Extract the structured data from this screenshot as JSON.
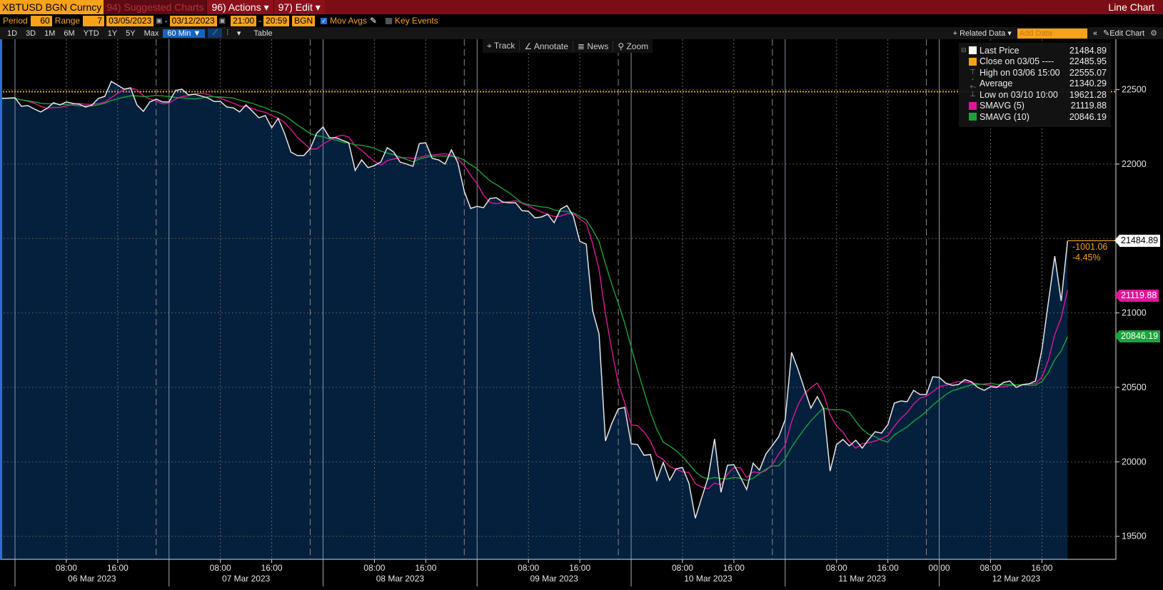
{
  "header": {
    "ticker": "XBTUSD BGN Curncy",
    "suggested": "94) Suggested Charts",
    "actions": "96) Actions ▾",
    "edit": "97) Edit ▾",
    "chart_type": "Line Chart"
  },
  "settings": {
    "period_label": "Period",
    "period_value": "60",
    "range_label": "Range",
    "range_value": "7",
    "start_date": "03/05/2023",
    "end_date": "03/12/2023",
    "start_time": "21:00",
    "end_time": "20:59",
    "source": "BGN",
    "mov_avgs": "Mov Avgs",
    "mov_avgs_checked": true,
    "key_events": "Key Events",
    "key_events_checked": false
  },
  "ranges": [
    "1D",
    "3D",
    "1M",
    "6M",
    "YTD",
    "1Y",
    "5Y",
    "Max"
  ],
  "interval": "60 Min ▼",
  "table_label": "Table",
  "related_data": "+ Related Data ▾",
  "add_data_placeholder": "Add Data",
  "edit_chart": "Edit Chart",
  "tools": [
    "Track",
    "Annotate",
    "News",
    "Zoom"
  ],
  "legend": [
    {
      "label": "Last Price",
      "value": "21484.89",
      "color": "#ffffff",
      "marker": "swatch"
    },
    {
      "label": "Close on 03/05 ----",
      "value": "22485.95",
      "color": "#f7a21b",
      "marker": "swatch"
    },
    {
      "label": "High on 03/06 15:00",
      "value": "22555.07",
      "marker": "high"
    },
    {
      "label": "Average",
      "value": "21340.29",
      "marker": "avg"
    },
    {
      "label": "Low on 03/10 10:00",
      "value": "19621.28",
      "marker": "low"
    },
    {
      "label": "SMAVG (5)",
      "value": "21119.88",
      "color": "#e0169a",
      "marker": "swatch"
    },
    {
      "label": "SMAVG (10)",
      "value": "20846.19",
      "color": "#1aa33a",
      "marker": "swatch"
    }
  ],
  "tags": {
    "last": "21484.89",
    "sma5": "21119.88",
    "sma10": "20846.19",
    "change": "-1001.06",
    "change_pct": "-4.45%"
  },
  "chart_data": {
    "type": "area",
    "start": "03/05/2023 21:00",
    "interval": "60 Min",
    "close_reference": 22485.95,
    "ylim": [
      19400,
      22800
    ],
    "yticks": [
      19500,
      20000,
      20500,
      21000,
      21500,
      22000,
      22500
    ],
    "grid": true,
    "colors": {
      "price": "#e6e6e6",
      "fill": "#04203d",
      "sma5": "#e0169a",
      "sma10": "#1aa33a",
      "close": "#f7a21b"
    },
    "sma_periods": [
      5,
      10
    ],
    "series": [
      {
        "name": "Last Price",
        "values": [
          22440,
          22441,
          22443,
          22445,
          22388,
          22393,
          22370,
          22350,
          22374,
          22412,
          22397,
          22417,
          22407,
          22402,
          22383,
          22397,
          22441,
          22455,
          22555.07,
          22530,
          22503,
          22512,
          22397,
          22354,
          22417,
          22436,
          22417,
          22417,
          22493,
          22503,
          22465,
          22469,
          22457,
          22445,
          22421,
          22421,
          22383,
          22378,
          22350,
          22397,
          22354,
          22311,
          22326,
          22244,
          22307,
          22206,
          22080,
          22057,
          22057,
          22105,
          22206,
          22249,
          22177,
          22177,
          22160,
          22143,
          21957,
          22028,
          21976,
          21990,
          22014,
          22110,
          22081,
          22014,
          22000,
          21985,
          22138,
          22143,
          22038,
          22028,
          22000,
          22095,
          22009,
          21817,
          21702,
          21716,
          21707,
          21769,
          21774,
          21745,
          21740,
          21740,
          21687,
          21683,
          21639,
          21644,
          21663,
          21606,
          21697,
          21721,
          21649,
          21481,
          21462,
          21016,
          20859,
          20140,
          20260,
          20356,
          20365,
          20121,
          20116,
          20044,
          20049,
          19876,
          19996,
          19876,
          19953,
          19962,
          19857,
          19621.28,
          19760,
          19895,
          20154,
          19795,
          19977,
          19981,
          19900,
          19814,
          19991,
          19945,
          20053,
          20110,
          20169,
          20284,
          20735,
          20620,
          20490,
          20361,
          20438,
          20356,
          19938,
          20116,
          20150,
          20107,
          20145,
          20092,
          20150,
          20202,
          20193,
          20250,
          20394,
          20409,
          20404,
          20480,
          20452,
          20452,
          20571,
          20567,
          20529,
          20514,
          20519,
          20552,
          20538,
          20500,
          20480,
          20504,
          20500,
          20533,
          20543,
          20500,
          20519,
          20524,
          20543,
          20754,
          21070,
          21382,
          21080,
          21484.89
        ]
      }
    ],
    "xticks": [
      {
        "label": "08:00",
        "time": "03/06 08:00"
      },
      {
        "label": "16:00",
        "time": "03/06 16:00"
      },
      {
        "label": "08:00",
        "time": "03/07 08:00"
      },
      {
        "label": "16:00",
        "time": "03/07 16:00"
      },
      {
        "label": "08:00",
        "time": "03/08 08:00"
      },
      {
        "label": "16:00",
        "time": "03/08 16:00"
      },
      {
        "label": "08:00",
        "time": "03/09 08:00"
      },
      {
        "label": "16:00",
        "time": "03/09 16:00"
      },
      {
        "label": "08:00",
        "time": "03/10 08:00"
      },
      {
        "label": "16:00",
        "time": "03/10 16:00"
      },
      {
        "label": "08:00",
        "time": "03/11 08:00"
      },
      {
        "label": "16:00",
        "time": "03/11 16:00"
      },
      {
        "label": "00:00",
        "time": "03/12 00:00"
      },
      {
        "label": "08:00",
        "time": "03/12 08:00"
      },
      {
        "label": "16:00",
        "time": "03/12 16:00"
      }
    ],
    "date_labels": [
      "06 Mar 2023",
      "07 Mar 2023",
      "08 Mar 2023",
      "09 Mar 2023",
      "10 Mar 2023",
      "11 Mar 2023",
      "12 Mar 2023"
    ]
  }
}
